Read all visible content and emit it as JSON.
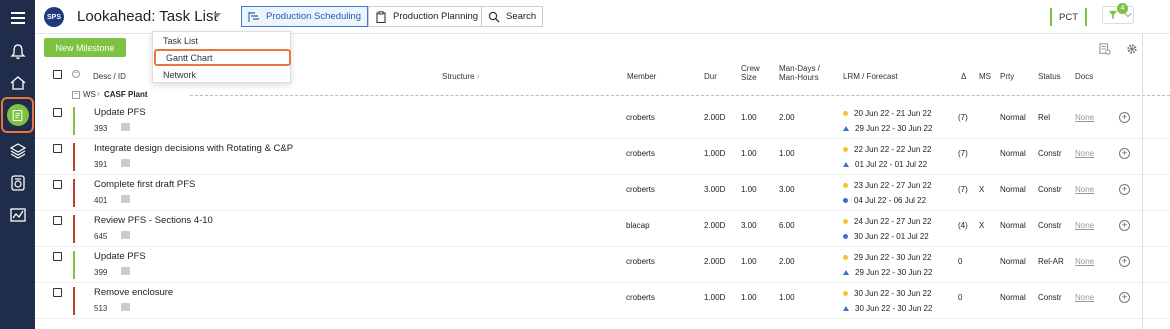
{
  "app": {
    "logo_text": "SPS",
    "title": "Lookahead: Task List"
  },
  "tabs": [
    {
      "label": "Production Scheduling",
      "active": true
    },
    {
      "label": "Production Planning",
      "active": false
    },
    {
      "label": "Search",
      "active": false
    }
  ],
  "header_right": {
    "project": "PCT",
    "filter_count": "4"
  },
  "toolbar": {
    "new_milestone": "New Milestone"
  },
  "view_menu": {
    "items": [
      "Task List",
      "Gantt Chart",
      "Network"
    ],
    "highlighted": "Gantt Chart"
  },
  "columns": {
    "desc": "Desc / ID",
    "structure": "Structure",
    "member": "Member",
    "dur": "Dur",
    "crew": "Crew Size",
    "mandays": "Man-Days / Man-Hours",
    "lrm": "LRM / Forecast",
    "delta": "Δ",
    "ms": "MS",
    "prty": "Prty",
    "status": "Status",
    "docs": "Docs"
  },
  "group": {
    "prefix": "WS",
    "name": "CASF Plant"
  },
  "colors": {
    "green": "#7dc242",
    "red": "#c0392b",
    "orange_highlight": "#e8763f",
    "sidebar": "#1f2d4a",
    "yellow_dot": "#f2c230",
    "blue_dot": "#3b6fc8"
  },
  "rows": [
    {
      "desc": "Update PFS",
      "id": "393",
      "bar": "green",
      "member": "croberts",
      "dur": "2.00D",
      "crew": "1.00",
      "mandays": "2.00",
      "lrm": "20 Jun 22 - 21 Jun 22",
      "forecast": "29 Jun 22 - 30 Jun 22",
      "forecast_marker": "triangle",
      "delta": "(7)",
      "ms": "",
      "prty": "Normal",
      "status": "Rel",
      "docs": "None"
    },
    {
      "desc": "Integrate design decisions with Rotating & C&P",
      "id": "391",
      "bar": "red",
      "member": "croberts",
      "dur": "1.00D",
      "crew": "1.00",
      "mandays": "1.00",
      "lrm": "22 Jun 22 - 22 Jun 22",
      "forecast": "01 Jul 22 - 01 Jul 22",
      "forecast_marker": "triangle",
      "delta": "(7)",
      "ms": "",
      "prty": "Normal",
      "status": "Constr",
      "docs": "None"
    },
    {
      "desc": "Complete first draft PFS",
      "id": "401",
      "bar": "red",
      "member": "croberts",
      "dur": "3.00D",
      "crew": "1.00",
      "mandays": "3.00",
      "lrm": "23 Jun 22 - 27 Jun 22",
      "forecast": "04 Jul 22 - 06 Jul 22",
      "forecast_marker": "dot",
      "delta": "(7)",
      "ms": "X",
      "prty": "Normal",
      "status": "Constr",
      "docs": "None"
    },
    {
      "desc": "Review PFS - Sections 4-10",
      "id": "645",
      "bar": "red",
      "member": "blacap",
      "dur": "2.00D",
      "crew": "3.00",
      "mandays": "6.00",
      "lrm": "24 Jun 22 - 27 Jun 22",
      "forecast": "30 Jun 22 - 01 Jul 22",
      "forecast_marker": "dot",
      "delta": "(4)",
      "ms": "X",
      "prty": "Normal",
      "status": "Constr",
      "docs": "None"
    },
    {
      "desc": "Update PFS",
      "id": "399",
      "bar": "green",
      "member": "croberts",
      "dur": "2.00D",
      "crew": "1.00",
      "mandays": "2.00",
      "lrm": "29 Jun 22 - 30 Jun 22",
      "forecast": "29 Jun 22 - 30 Jun 22",
      "forecast_marker": "triangle",
      "delta": "0",
      "ms": "",
      "prty": "Normal",
      "status": "Rel-AR",
      "docs": "None"
    },
    {
      "desc": "Remove enclosure",
      "id": "513",
      "bar": "red",
      "member": "croberts",
      "dur": "1.00D",
      "crew": "1.00",
      "mandays": "1.00",
      "lrm": "30 Jun 22 - 30 Jun 22",
      "forecast": "30 Jun 22 - 30 Jun 22",
      "forecast_marker": "triangle",
      "delta": "0",
      "ms": "",
      "prty": "Normal",
      "status": "Constr",
      "docs": "None"
    }
  ]
}
